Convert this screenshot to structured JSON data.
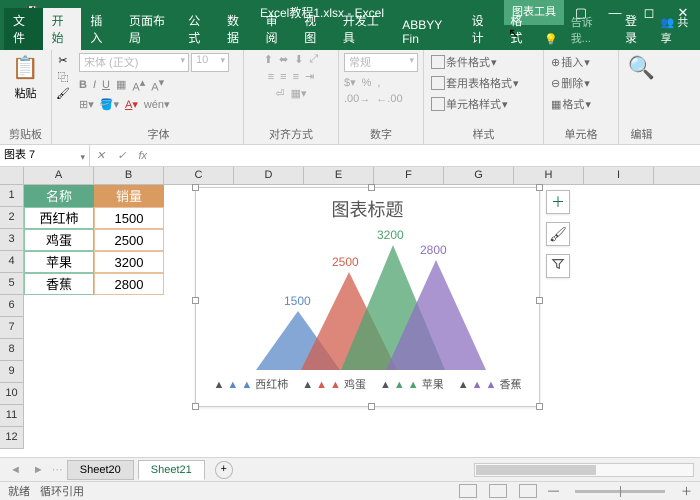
{
  "titlebar": {
    "title": "Excel教程1.xlsx - Excel",
    "tools": "图表工具"
  },
  "tabs": {
    "file": "文件",
    "items": [
      "开始",
      "插入",
      "页面布局",
      "公式",
      "数据",
      "审阅",
      "视图",
      "开发工具",
      "ABBYY Fin",
      "设计",
      "格式"
    ],
    "tell": "告诉我...",
    "login": "登录",
    "share": "共享"
  },
  "ribbon": {
    "clipboard": "剪贴板",
    "paste": "粘贴",
    "font_group": "字体",
    "font_name": "宋体 (正文)",
    "font_size": "10",
    "align_group": "对齐方式",
    "number_group": "数字",
    "number_fmt": "常规",
    "styles_group": "样式",
    "styles_cond": "条件格式",
    "styles_table": "套用表格格式",
    "styles_cell": "单元格样式",
    "cells_group": "单元格",
    "cells_insert": "插入",
    "cells_delete": "删除",
    "cells_format": "格式",
    "edit_group": "编辑"
  },
  "namebox": {
    "value": "图表 7"
  },
  "table": {
    "col_a": "名称",
    "col_b": "销量",
    "rows": [
      {
        "a": "西红柿",
        "b": "1500"
      },
      {
        "a": "鸡蛋",
        "b": "2500"
      },
      {
        "a": "苹果",
        "b": "3200"
      },
      {
        "a": "香蕉",
        "b": "2800"
      }
    ]
  },
  "chart_data": {
    "type": "area",
    "title": "图表标题",
    "categories": [
      "西红柿",
      "鸡蛋",
      "苹果",
      "香蕉"
    ],
    "values": [
      1500,
      2500,
      3200,
      2800
    ],
    "colors": [
      "#5b8ac7",
      "#d25f4f",
      "#4fa36f",
      "#8e72c0"
    ],
    "ylim": [
      0,
      3500
    ]
  },
  "sheets": {
    "prev": "Sheet20",
    "active": "Sheet21"
  },
  "status": {
    "ready": "就绪",
    "circ": "循环引用"
  },
  "cols": [
    "A",
    "B",
    "C",
    "D",
    "E",
    "F",
    "G",
    "H",
    "I"
  ]
}
